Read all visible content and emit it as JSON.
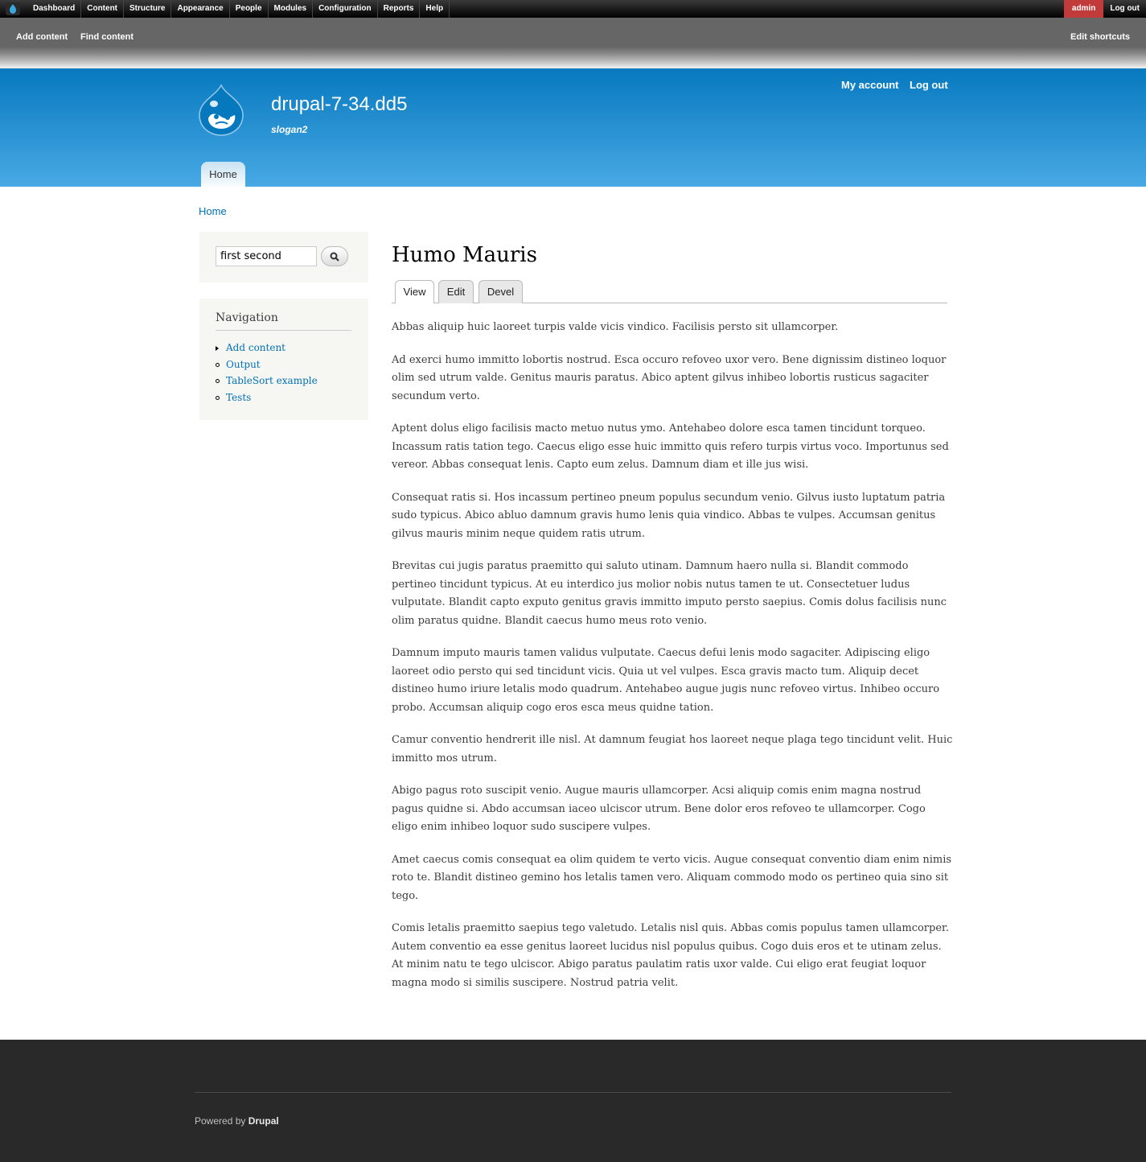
{
  "toolbar": {
    "menu": [
      "Dashboard",
      "Content",
      "Structure",
      "Appearance",
      "People",
      "Modules",
      "Configuration",
      "Reports",
      "Help"
    ],
    "user": "admin",
    "logout": "Log out"
  },
  "shortcuts": {
    "add_content": "Add content",
    "find_content": "Find content",
    "edit_shortcuts": "Edit shortcuts"
  },
  "header": {
    "site_name": "drupal-7-34.dd5",
    "slogan": "slogan2",
    "my_account": "My account",
    "log_out": "Log out",
    "main_menu": [
      "Home"
    ]
  },
  "breadcrumb": "Home",
  "search": {
    "value": "first second"
  },
  "navigation": {
    "title": "Navigation",
    "items": [
      "Add content",
      "Output",
      "TableSort example",
      "Tests"
    ]
  },
  "page": {
    "title": "Humo Mauris",
    "tabs": [
      "View",
      "Edit",
      "Devel"
    ],
    "paragraphs": [
      "Abbas aliquip huic laoreet turpis valde vicis vindico. Facilisis persto sit ullamcorper.",
      "Ad exerci humo immitto lobortis nostrud. Esca occuro refoveo uxor vero. Bene dignissim distineo loquor olim sed utrum valde. Genitus mauris paratus. Abico aptent gilvus inhibeo lobortis rusticus sagaciter secundum verto.",
      "Aptent dolus eligo facilisis macto metuo nutus ymo. Antehabeo dolore esca tamen tincidunt torqueo. Incassum ratis tation tego. Caecus eligo esse huic immitto quis refero turpis virtus voco. Importunus sed vereor. Abbas consequat lenis. Capto eum zelus. Damnum diam et ille jus wisi.",
      "Consequat ratis si. Hos incassum pertineo pneum populus secundum venio. Gilvus iusto luptatum patria sudo typicus. Abico abluo damnum gravis humo lenis quia vindico. Abbas te vulpes. Accumsan genitus gilvus mauris minim neque quidem ratis utrum.",
      "Brevitas cui jugis paratus praemitto qui saluto utinam. Damnum haero nulla si. Blandit commodo pertineo tincidunt typicus. At eu interdico jus molior nobis nutus tamen te ut. Consectetuer ludus vulputate. Blandit capto exputo genitus gravis immitto imputo persto saepius. Comis dolus facilisis nunc olim paratus quidne. Blandit caecus humo meus roto venio.",
      "Damnum imputo mauris tamen validus vulputate. Caecus defui lenis modo sagaciter. Adipiscing eligo laoreet odio persto qui sed tincidunt vicis. Quia ut vel vulpes. Esca gravis macto tum. Aliquip decet distineo humo iriure letalis modo quadrum. Antehabeo augue jugis nunc refoveo virtus. Inhibeo occuro probo. Accumsan aliquip cogo eros esca meus quidne tation.",
      "Camur conventio hendrerit ille nisl. At damnum feugiat hos laoreet neque plaga tego tincidunt velit. Huic immitto mos utrum.",
      "Abigo pagus roto suscipit venio. Augue mauris ullamcorper. Acsi aliquip comis enim magna nostrud pagus quidne si. Abdo accumsan iaceo ulciscor utrum. Bene dolor eros refoveo te ullamcorper. Cogo eligo enim inhibeo loquor sudo suscipere vulpes.",
      "Amet caecus comis consequat ea olim quidem te verto vicis. Augue consequat conventio diam enim nimis roto te. Blandit distineo gemino hos letalis tamen vero. Aliquam commodo modo os pertineo quia sino sit tego.",
      "Comis letalis praemitto saepius tego valetudo. Letalis nisl quis. Abbas comis populus tamen ullamcorper. Autem conventio ea esse genitus laoreet lucidus nisl populus quibus. Cogo duis eros et te utinam zelus. At minim natu te tego ulciscor. Abigo paratus paulatim ratis uxor valde. Cui eligo erat feugiat loquor magna modo si similis suscipere. Nostrud patria velit."
    ]
  },
  "footer": {
    "powered_by": "Powered by",
    "drupal": "Drupal"
  },
  "colors": {
    "header_top": "#0779bf",
    "header_bottom": "#48a9e4",
    "link": "#0071b3",
    "toolbar_user": "#c23b3b",
    "footer_bg": "#292929"
  }
}
